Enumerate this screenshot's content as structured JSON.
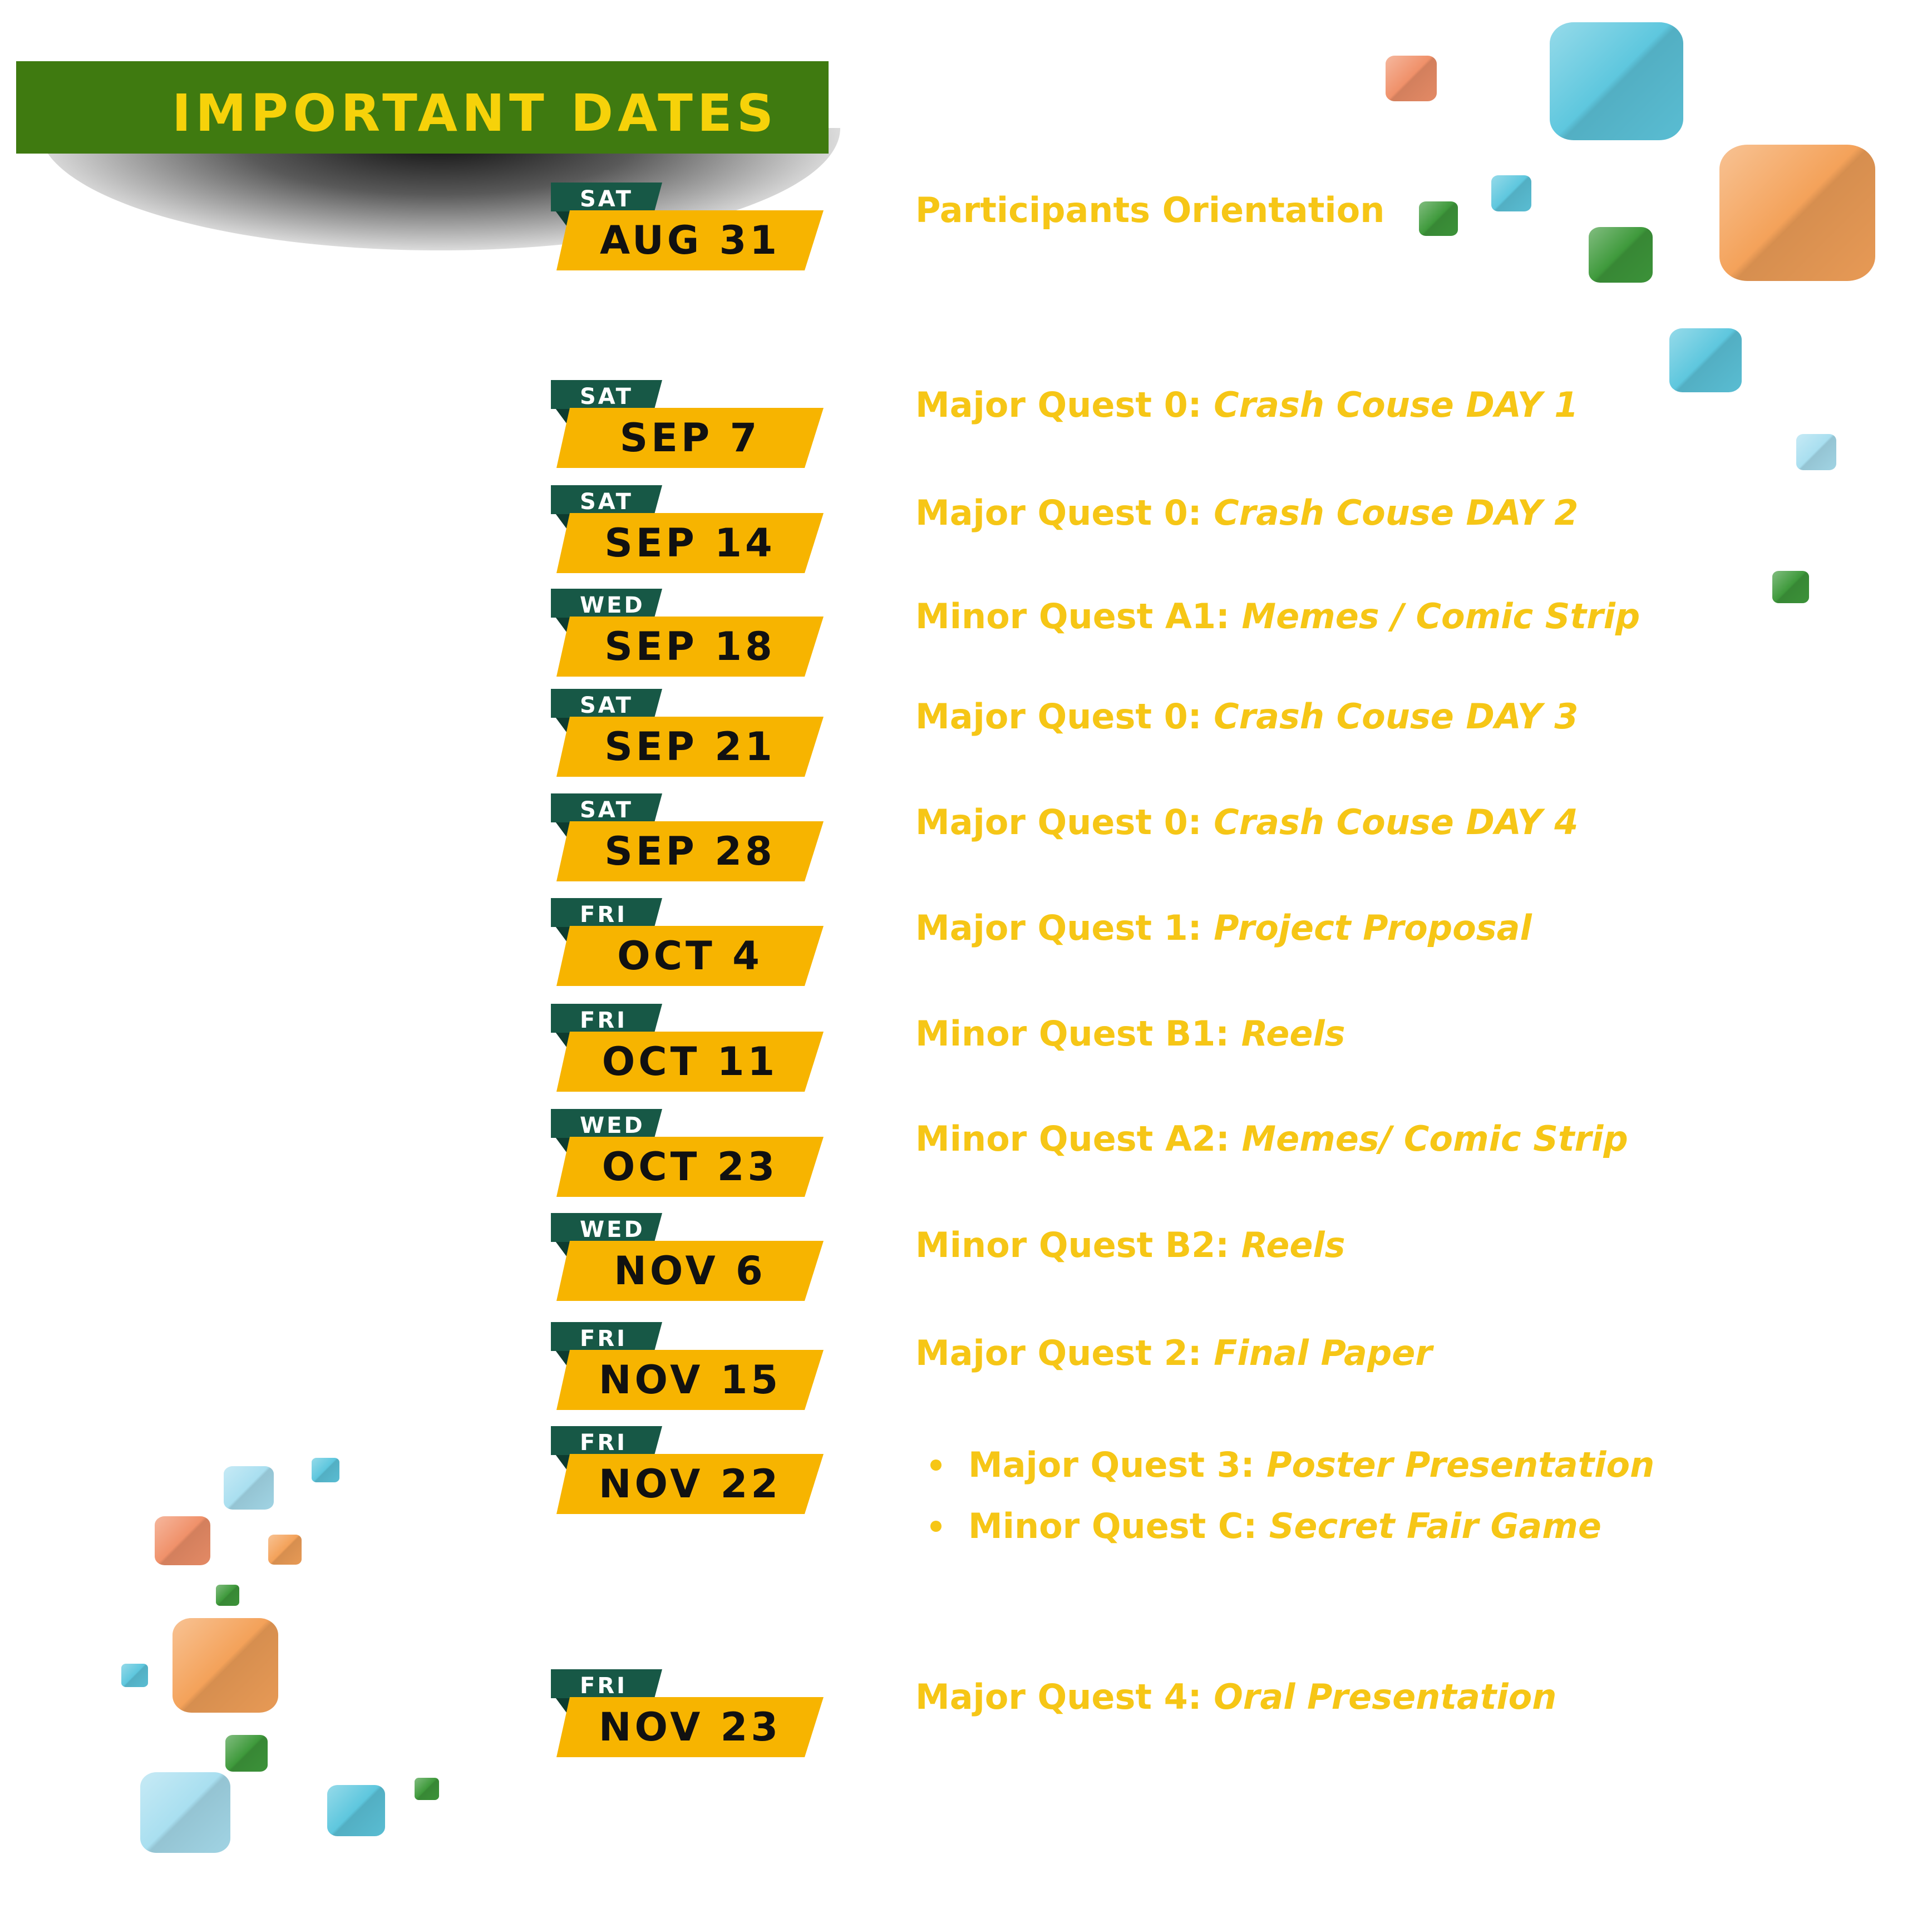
{
  "header": {
    "title": "IMPORTANT DATES"
  },
  "colors": {
    "banner_green": "#3f7a10",
    "title_yellow": "#f6d20a",
    "ribbon_yellow": "#f7b400",
    "day_tab_green": "#175846",
    "event_text": "#f6c616"
  },
  "schedule": [
    {
      "day": "SAT",
      "date": "AUG 31",
      "prefix": "Participants Orientation",
      "title": ""
    },
    {
      "day": "SAT",
      "date": "SEP 7",
      "prefix": "Major Quest 0: ",
      "title": "Crash Couse DAY 1"
    },
    {
      "day": "SAT",
      "date": "SEP 14",
      "prefix": "Major Quest 0: ",
      "title": "Crash Couse DAY 2"
    },
    {
      "day": "WED",
      "date": "SEP 18",
      "prefix": "Minor Quest A1: ",
      "title": "Memes / Comic Strip"
    },
    {
      "day": "SAT",
      "date": "SEP 21",
      "prefix": "Major Quest 0: ",
      "title": "Crash Couse DAY 3"
    },
    {
      "day": "SAT",
      "date": "SEP 28",
      "prefix": "Major Quest 0: ",
      "title": "Crash Couse DAY 4"
    },
    {
      "day": "FRI",
      "date": "OCT 4",
      "prefix": "Major Quest 1: ",
      "title": "Project Proposal"
    },
    {
      "day": "FRI",
      "date": "OCT 11",
      "prefix": "Minor Quest B1: ",
      "title": "Reels"
    },
    {
      "day": "WED",
      "date": "OCT 23",
      "prefix": "Minor Quest A2: ",
      "title": "Memes/ Comic Strip"
    },
    {
      "day": "WED",
      "date": "NOV 6",
      "prefix": "Minor Quest B2: ",
      "title": "Reels"
    },
    {
      "day": "FRI",
      "date": "NOV 15",
      "prefix": "Major Quest 2: ",
      "title": "Final Paper"
    },
    {
      "day": "FRI",
      "date": "NOV 22",
      "items": [
        {
          "prefix": "Major Quest 3: ",
          "title": "Poster Presentation"
        },
        {
          "prefix": "Minor Quest C: ",
          "title": "Secret Fair Game"
        }
      ]
    },
    {
      "day": "FRI",
      "date": "NOV 23",
      "prefix": "Major Quest 4: ",
      "title": "Oral Presentation"
    }
  ]
}
